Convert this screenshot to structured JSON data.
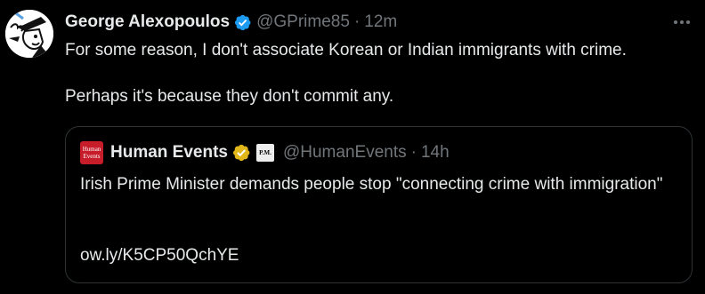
{
  "tweet": {
    "author": {
      "display_name": "George Alexopoulos",
      "handle": "@GPrime85",
      "separator": "·",
      "timestamp": "12m",
      "verified": true,
      "avatar_icon": "cartoon-face-avatar"
    },
    "more_icon": "more-options-icon",
    "text_lines": [
      "For some reason, I don't associate Korean or Indian immigrants with crime.",
      "Perhaps it's because they don't commit any."
    ],
    "quoted": {
      "avatar_text_top": "Human",
      "avatar_text_bottom": "Events",
      "display_name": "Human Events",
      "affiliate_badge_text": "P.M.",
      "handle": "@HumanEvents",
      "separator": "·",
      "timestamp": "14h",
      "text": "Irish Prime Minister demands people stop \"connecting crime with immigration\"",
      "link": "ow.ly/K5CP50QchYE"
    }
  },
  "colors": {
    "background": "#000000",
    "primary_text": "#e7e9ea",
    "secondary_text": "#71767b",
    "border": "#2f3336",
    "verified_blue": "#1d9bf0",
    "verified_gold": "#e2b719",
    "brand_red": "#c71d2a"
  }
}
